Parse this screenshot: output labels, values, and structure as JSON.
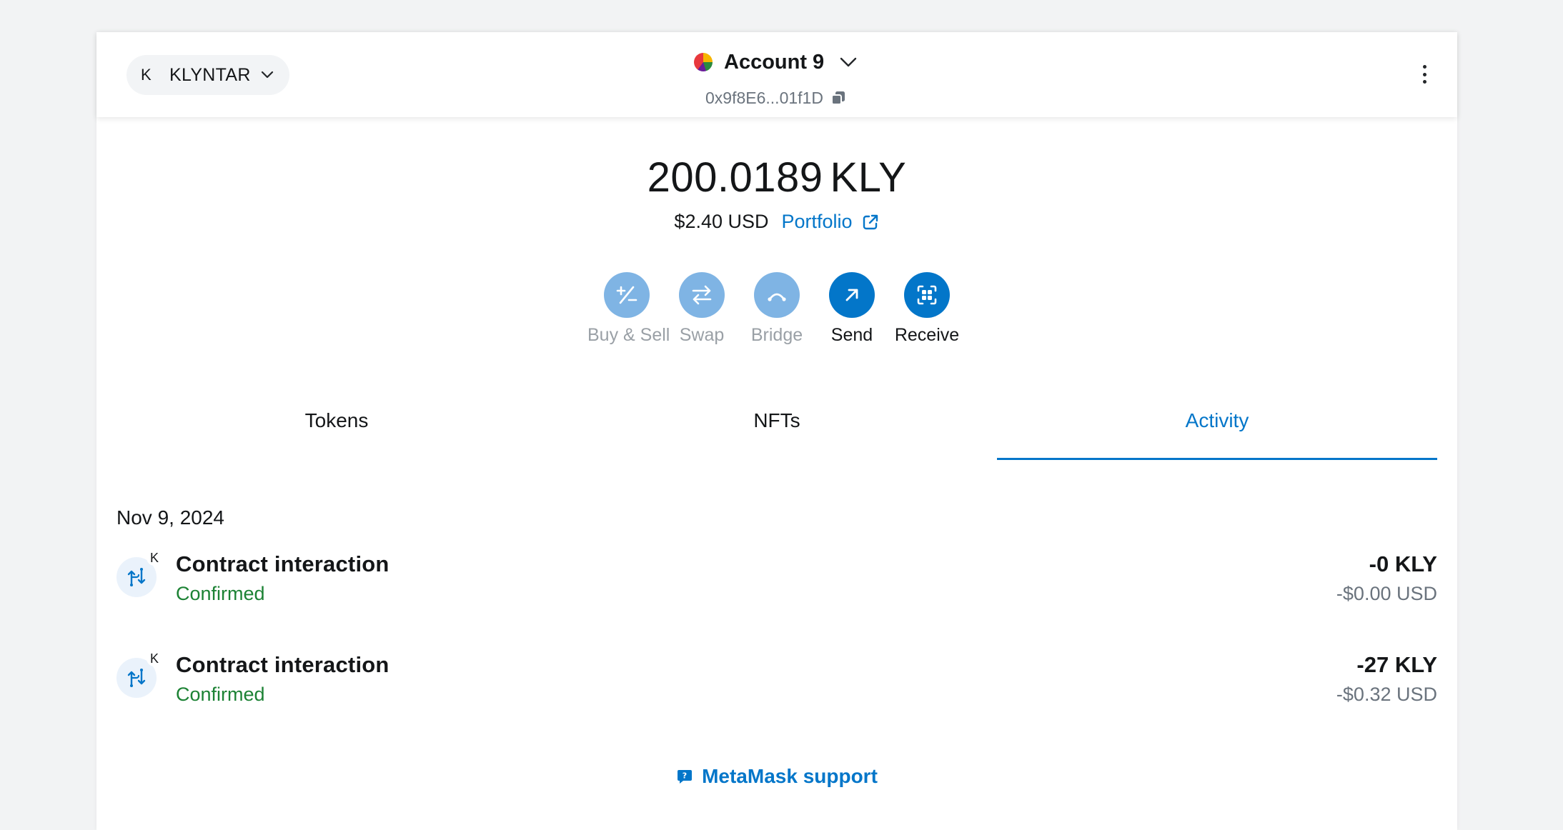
{
  "header": {
    "network": {
      "avatar_letter": "K",
      "name": "KLYNTAR",
      "chevron_icon": "chevron-down-icon"
    },
    "account": {
      "name": "Account 9",
      "address": "0x9f8E6...01f1D"
    },
    "menu_icon": "kebab-menu-icon"
  },
  "balance": {
    "amount": "200.0189",
    "currency": "KLY",
    "fiat": "$2.40 USD",
    "portfolio_label": "Portfolio"
  },
  "actions": [
    {
      "label": "Buy & Sell",
      "icon": "plus-minus-icon",
      "enabled": false
    },
    {
      "label": "Swap",
      "icon": "swap-arrows-icon",
      "enabled": false
    },
    {
      "label": "Bridge",
      "icon": "bridge-icon",
      "enabled": false
    },
    {
      "label": "Send",
      "icon": "arrow-up-right-icon",
      "enabled": true
    },
    {
      "label": "Receive",
      "icon": "scan-qr-icon",
      "enabled": true
    }
  ],
  "tabs": [
    {
      "label": "Tokens",
      "active": false
    },
    {
      "label": "NFTs",
      "active": false
    },
    {
      "label": "Activity",
      "active": true
    }
  ],
  "activity": {
    "date": "Nov 9, 2024",
    "items": [
      {
        "badge": "K",
        "title": "Contract interaction",
        "status": "Confirmed",
        "amount": "-0 KLY",
        "fiat": "-$0.00 USD"
      },
      {
        "badge": "K",
        "title": "Contract interaction",
        "status": "Confirmed",
        "amount": "-27 KLY",
        "fiat": "-$0.32 USD"
      }
    ]
  },
  "support": {
    "label": "MetaMask support"
  },
  "colors": {
    "accent": "#0376c9",
    "accent_disabled": "#7fb4e4",
    "success": "#1c8234",
    "muted": "#6a737d",
    "background": "#f2f3f4"
  }
}
